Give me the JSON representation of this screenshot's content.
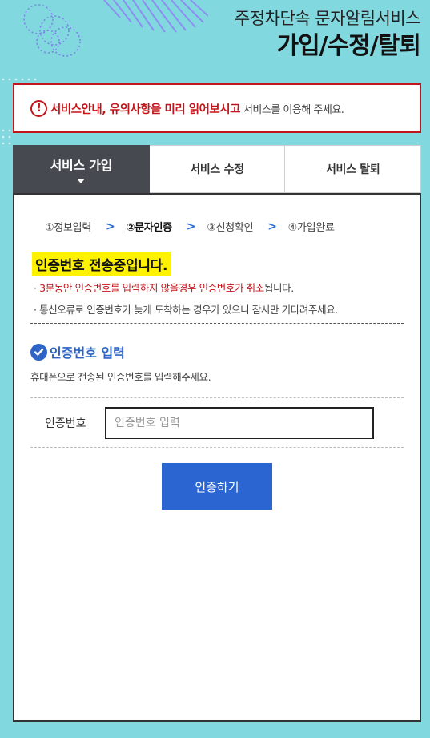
{
  "header": {
    "subtitle": "주정차단속 문자알림서비스",
    "title": "가입/수정/탈퇴"
  },
  "notice": {
    "icon": "exclamation-circle-icon",
    "emphasis": "서비스안내, 유의사항을 미리 읽어보시고",
    "rest": "서비스를 이용해 주세요."
  },
  "tabs": [
    {
      "label": "서비스 가입",
      "active": true
    },
    {
      "label": "서비스 수정",
      "active": false
    },
    {
      "label": "서비스 탈퇴",
      "active": false
    }
  ],
  "steps": [
    "①정보입력",
    "②문자인증",
    "③신청확인",
    "④가입완료"
  ],
  "current_step": 1,
  "step_separator": ">",
  "status": {
    "heading": "인증번호 전송중입니다.",
    "bullet_mark": "·",
    "bullet1_red1": "3분동안 인증번호를 입력하지 않을경우 인증번호가 취소",
    "bullet1_tail": "됩니다.",
    "bullet2": "통신오류로 인증번호가 늦게 도착하는 경우가 있으니 잠시만 기다려주세요."
  },
  "section": {
    "icon": "check-circle-icon",
    "title": "인증번호 입력",
    "description": "휴대폰으로 전송된 인증번호를 입력해주세요."
  },
  "form": {
    "label": "인증번호",
    "placeholder": "인증번호 입력",
    "value": ""
  },
  "submit_label": "인증하기",
  "colors": {
    "background": "#82d8df",
    "accent_red": "#c2151b",
    "accent_blue": "#2a65d2",
    "tab_active": "#474950",
    "highlight": "#fff200"
  }
}
